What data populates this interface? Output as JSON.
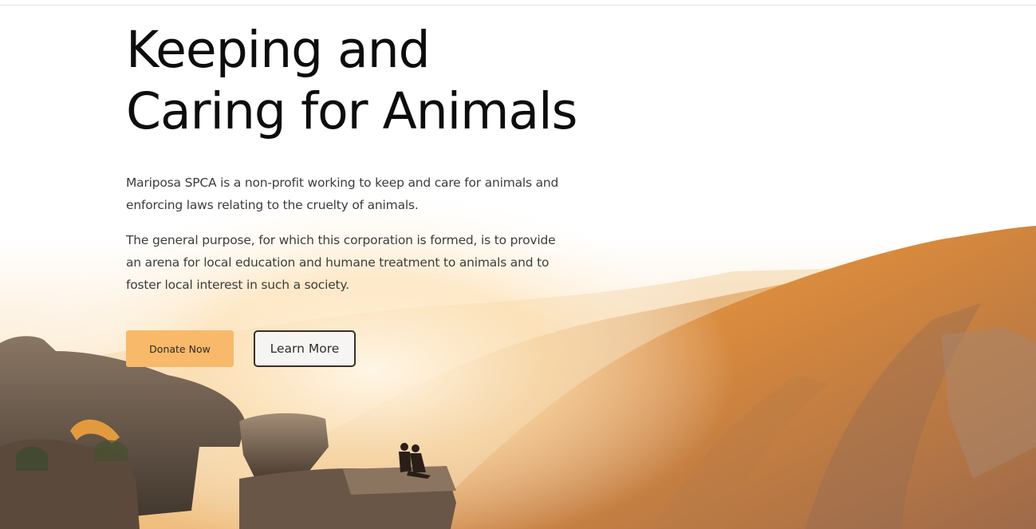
{
  "hero": {
    "headline_line1": "Keeping and",
    "headline_line2": "Caring for Animals",
    "paragraph1": "Mariposa SPCA is a non-profit working to keep and care for animals and enforcing laws relating to the cruelty of animals.",
    "paragraph2": "The general purpose, for which this corporation is formed, is to provide an arena for local education and humane treatment to animals and to foster local interest in such a society.",
    "donate_label": "Donate Now",
    "learn_more_label": "Learn More",
    "background_image": "sunset-canyon-overlook-with-couple-on-cliff"
  },
  "colors": {
    "accent": "#f9b96a",
    "heading": "#0d0d0d",
    "body_text": "#3d3d3d",
    "outline_button_border": "#3a2e26"
  }
}
